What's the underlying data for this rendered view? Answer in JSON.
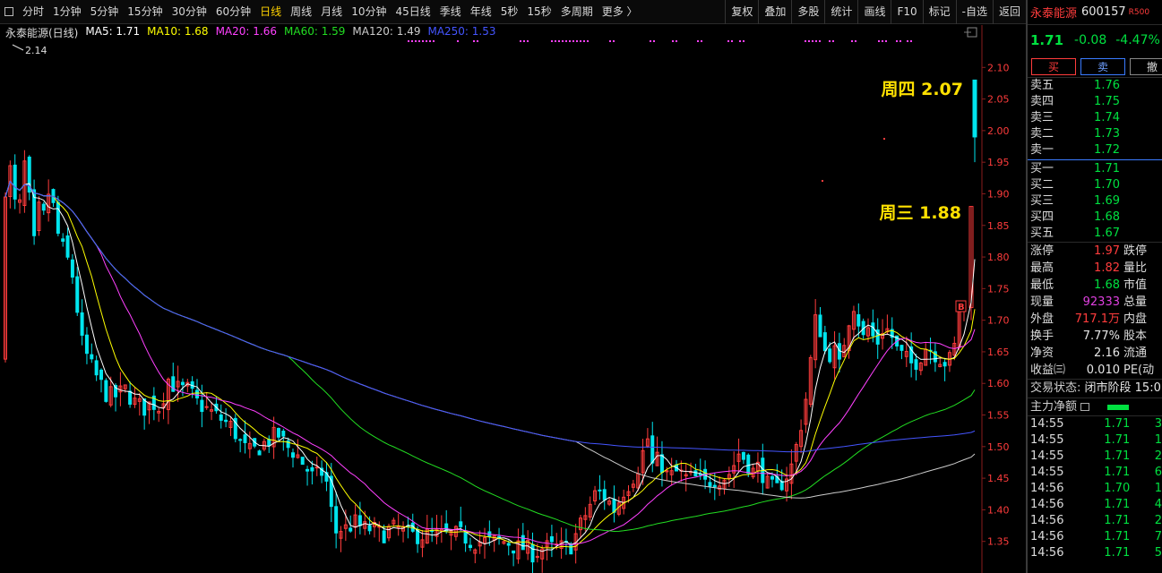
{
  "toolbar": {
    "periods": [
      {
        "label": "分时",
        "active": false
      },
      {
        "label": "1分钟",
        "active": false
      },
      {
        "label": "5分钟",
        "active": false
      },
      {
        "label": "15分钟",
        "active": false
      },
      {
        "label": "30分钟",
        "active": false
      },
      {
        "label": "60分钟",
        "active": false
      },
      {
        "label": "日线",
        "active": true
      },
      {
        "label": "周线",
        "active": false
      },
      {
        "label": "月线",
        "active": false
      },
      {
        "label": "10分钟",
        "active": false
      },
      {
        "label": "45日线",
        "active": false
      },
      {
        "label": "季线",
        "active": false
      },
      {
        "label": "年线",
        "active": false
      },
      {
        "label": "5秒",
        "active": false
      },
      {
        "label": "15秒",
        "active": false
      },
      {
        "label": "多周期",
        "active": false
      },
      {
        "label": "更多 〉",
        "active": false
      }
    ],
    "tools": [
      "复权",
      "叠加",
      "多股",
      "统计",
      "画线",
      "F10",
      "标记",
      "-自选",
      "返回"
    ]
  },
  "legend": {
    "stock": "永泰能源(日线)",
    "items": [
      {
        "label": "MA5: 1.71",
        "color": "#ffffff"
      },
      {
        "label": "MA10: 1.68",
        "color": "#ffff00"
      },
      {
        "label": "MA20: 1.66",
        "color": "#ff40ff"
      },
      {
        "label": "MA60: 1.59",
        "color": "#22dd22"
      },
      {
        "label": "MA120: 1.49",
        "color": "#cccccc"
      },
      {
        "label": "MA250: 1.53",
        "color": "#4455ff"
      }
    ]
  },
  "chart_data": {
    "type": "candlestick",
    "y_ticks": [
      "2.10",
      "2.05",
      "2.00",
      "1.95",
      "1.90",
      "1.85",
      "1.80",
      "1.75",
      "1.70",
      "1.65",
      "1.60",
      "1.55",
      "1.50",
      "1.45",
      "1.40",
      "1.35"
    ],
    "ylim": [
      1.3,
      2.15
    ],
    "high_mark": "2.14",
    "annotations": [
      {
        "text": "周四 2.07",
        "value": 2.07
      },
      {
        "text": "周三 1.88",
        "value": 1.88
      }
    ],
    "buy_marker": "B",
    "colors": {
      "up": "#ff3c3c",
      "down": "#00e5ee",
      "ma5": "#ffffff",
      "ma10": "#ffff00",
      "ma20": "#ff40ff",
      "ma60": "#22dd22",
      "ma120": "#cccccc",
      "ma250": "#4455ff",
      "annotation": "#ffe000"
    },
    "anchors": [
      [
        0,
        1.63
      ],
      [
        4,
        1.86
      ],
      [
        8,
        1.96
      ],
      [
        14,
        1.92
      ],
      [
        20,
        1.84
      ],
      [
        26,
        1.96
      ],
      [
        32,
        1.9
      ],
      [
        38,
        1.82
      ],
      [
        44,
        1.88
      ],
      [
        50,
        1.86
      ],
      [
        56,
        1.92
      ],
      [
        62,
        1.85
      ],
      [
        68,
        1.82
      ],
      [
        74,
        1.8
      ],
      [
        80,
        1.78
      ],
      [
        86,
        1.72
      ],
      [
        92,
        1.66
      ],
      [
        98,
        1.64
      ],
      [
        104,
        1.62
      ],
      [
        112,
        1.6
      ],
      [
        120,
        1.58
      ],
      [
        130,
        1.58
      ],
      [
        140,
        1.59
      ],
      [
        150,
        1.57
      ],
      [
        160,
        1.56
      ],
      [
        170,
        1.57
      ],
      [
        180,
        1.56
      ],
      [
        186,
        1.61
      ],
      [
        192,
        1.6
      ],
      [
        200,
        1.59
      ],
      [
        210,
        1.59
      ],
      [
        220,
        1.57
      ],
      [
        230,
        1.56
      ],
      [
        240,
        1.55
      ],
      [
        250,
        1.54
      ],
      [
        260,
        1.53
      ],
      [
        270,
        1.5
      ],
      [
        280,
        1.49
      ],
      [
        290,
        1.5
      ],
      [
        300,
        1.51
      ],
      [
        310,
        1.52
      ],
      [
        320,
        1.5
      ],
      [
        330,
        1.49
      ],
      [
        340,
        1.47
      ],
      [
        350,
        1.45
      ],
      [
        360,
        1.46
      ],
      [
        368,
        1.43
      ],
      [
        372,
        1.36
      ],
      [
        378,
        1.37
      ],
      [
        386,
        1.37
      ],
      [
        396,
        1.38
      ],
      [
        406,
        1.37
      ],
      [
        416,
        1.37
      ],
      [
        426,
        1.36
      ],
      [
        436,
        1.37
      ],
      [
        446,
        1.37
      ],
      [
        456,
        1.36
      ],
      [
        466,
        1.36
      ],
      [
        476,
        1.36
      ],
      [
        486,
        1.36
      ],
      [
        496,
        1.36
      ],
      [
        506,
        1.36
      ],
      [
        516,
        1.36
      ],
      [
        526,
        1.35
      ],
      [
        536,
        1.35
      ],
      [
        546,
        1.35
      ],
      [
        556,
        1.35
      ],
      [
        566,
        1.35
      ],
      [
        576,
        1.34
      ],
      [
        586,
        1.34
      ],
      [
        596,
        1.33
      ],
      [
        606,
        1.34
      ],
      [
        616,
        1.34
      ],
      [
        626,
        1.34
      ],
      [
        636,
        1.34
      ],
      [
        646,
        1.37
      ],
      [
        656,
        1.4
      ],
      [
        666,
        1.43
      ],
      [
        676,
        1.42
      ],
      [
        686,
        1.4
      ],
      [
        696,
        1.43
      ],
      [
        706,
        1.45
      ],
      [
        716,
        1.48
      ],
      [
        722,
        1.52
      ],
      [
        728,
        1.47
      ],
      [
        736,
        1.48
      ],
      [
        746,
        1.45
      ],
      [
        756,
        1.46
      ],
      [
        766,
        1.45
      ],
      [
        776,
        1.45
      ],
      [
        786,
        1.44
      ],
      [
        796,
        1.45
      ],
      [
        806,
        1.45
      ],
      [
        816,
        1.46
      ],
      [
        824,
        1.49
      ],
      [
        832,
        1.48
      ],
      [
        840,
        1.46
      ],
      [
        848,
        1.47
      ],
      [
        856,
        1.44
      ],
      [
        866,
        1.43
      ],
      [
        876,
        1.45
      ],
      [
        884,
        1.47
      ],
      [
        892,
        1.52
      ],
      [
        900,
        1.58
      ],
      [
        906,
        1.65
      ],
      [
        912,
        1.72
      ],
      [
        918,
        1.66
      ],
      [
        924,
        1.64
      ],
      [
        930,
        1.66
      ],
      [
        936,
        1.62
      ],
      [
        944,
        1.68
      ],
      [
        952,
        1.73
      ],
      [
        958,
        1.7
      ],
      [
        964,
        1.67
      ],
      [
        970,
        1.69
      ],
      [
        978,
        1.66
      ],
      [
        986,
        1.69
      ],
      [
        994,
        1.68
      ],
      [
        1002,
        1.65
      ],
      [
        1010,
        1.64
      ],
      [
        1018,
        1.63
      ],
      [
        1026,
        1.64
      ],
      [
        1034,
        1.66
      ],
      [
        1042,
        1.65
      ],
      [
        1050,
        1.64
      ],
      [
        1058,
        1.63
      ],
      [
        1066,
        1.66
      ],
      [
        1072,
        1.74
      ],
      [
        1078,
        1.72
      ],
      [
        1084,
        1.86
      ],
      [
        1088,
        2.07
      ]
    ]
  },
  "side": {
    "name": "永泰能源",
    "code": "600157",
    "tag": "R500",
    "price": "1.71",
    "change": "-0.08",
    "pct": "-4.47%",
    "buy_btn": "买",
    "sell_btn": "卖",
    "cancel_btn": "撤",
    "asks": [
      {
        "l": "卖五",
        "p": "1.76"
      },
      {
        "l": "卖四",
        "p": "1.75"
      },
      {
        "l": "卖三",
        "p": "1.74"
      },
      {
        "l": "卖二",
        "p": "1.73"
      },
      {
        "l": "卖一",
        "p": "1.72"
      }
    ],
    "bids": [
      {
        "l": "买一",
        "p": "1.71"
      },
      {
        "l": "买二",
        "p": "1.70"
      },
      {
        "l": "买三",
        "p": "1.69"
      },
      {
        "l": "买四",
        "p": "1.68"
      },
      {
        "l": "买五",
        "p": "1.67"
      }
    ],
    "stats": [
      {
        "l": "涨停",
        "v": "1.97",
        "c": "v-red",
        "l2": "跌停"
      },
      {
        "l": "最高",
        "v": "1.82",
        "c": "v-red",
        "l2": "量比"
      },
      {
        "l": "最低",
        "v": "1.68",
        "c": "v-green",
        "l2": "市值"
      },
      {
        "l": "现量",
        "v": "92333",
        "c": "v-mag",
        "l2": "总量"
      },
      {
        "l": "外盘",
        "v": "717.1万",
        "c": "v-red",
        "l2": "内盘"
      },
      {
        "l": "换手",
        "v": "7.77%",
        "c": "v-white",
        "l2": "股本"
      },
      {
        "l": "净资",
        "v": "2.16",
        "c": "v-white",
        "l2": "流通"
      },
      {
        "l": "收益㈢",
        "v": "0.010",
        "c": "v-white",
        "l2": "PE(动"
      }
    ],
    "trade_label": "交易状态:",
    "trade_status": "闭市阶段 15:0",
    "mainflow_label": "主力净额",
    "ticks": [
      {
        "t": "14:55",
        "p": "1.71",
        "v": "3"
      },
      {
        "t": "14:55",
        "p": "1.71",
        "v": "1"
      },
      {
        "t": "14:55",
        "p": "1.71",
        "v": "2"
      },
      {
        "t": "14:55",
        "p": "1.71",
        "v": "6"
      },
      {
        "t": "14:56",
        "p": "1.70",
        "v": "1"
      },
      {
        "t": "14:56",
        "p": "1.71",
        "v": "4"
      },
      {
        "t": "14:56",
        "p": "1.71",
        "v": "2"
      },
      {
        "t": "14:56",
        "p": "1.71",
        "v": "7"
      },
      {
        "t": "14:56",
        "p": "1.71",
        "v": "5"
      }
    ]
  }
}
